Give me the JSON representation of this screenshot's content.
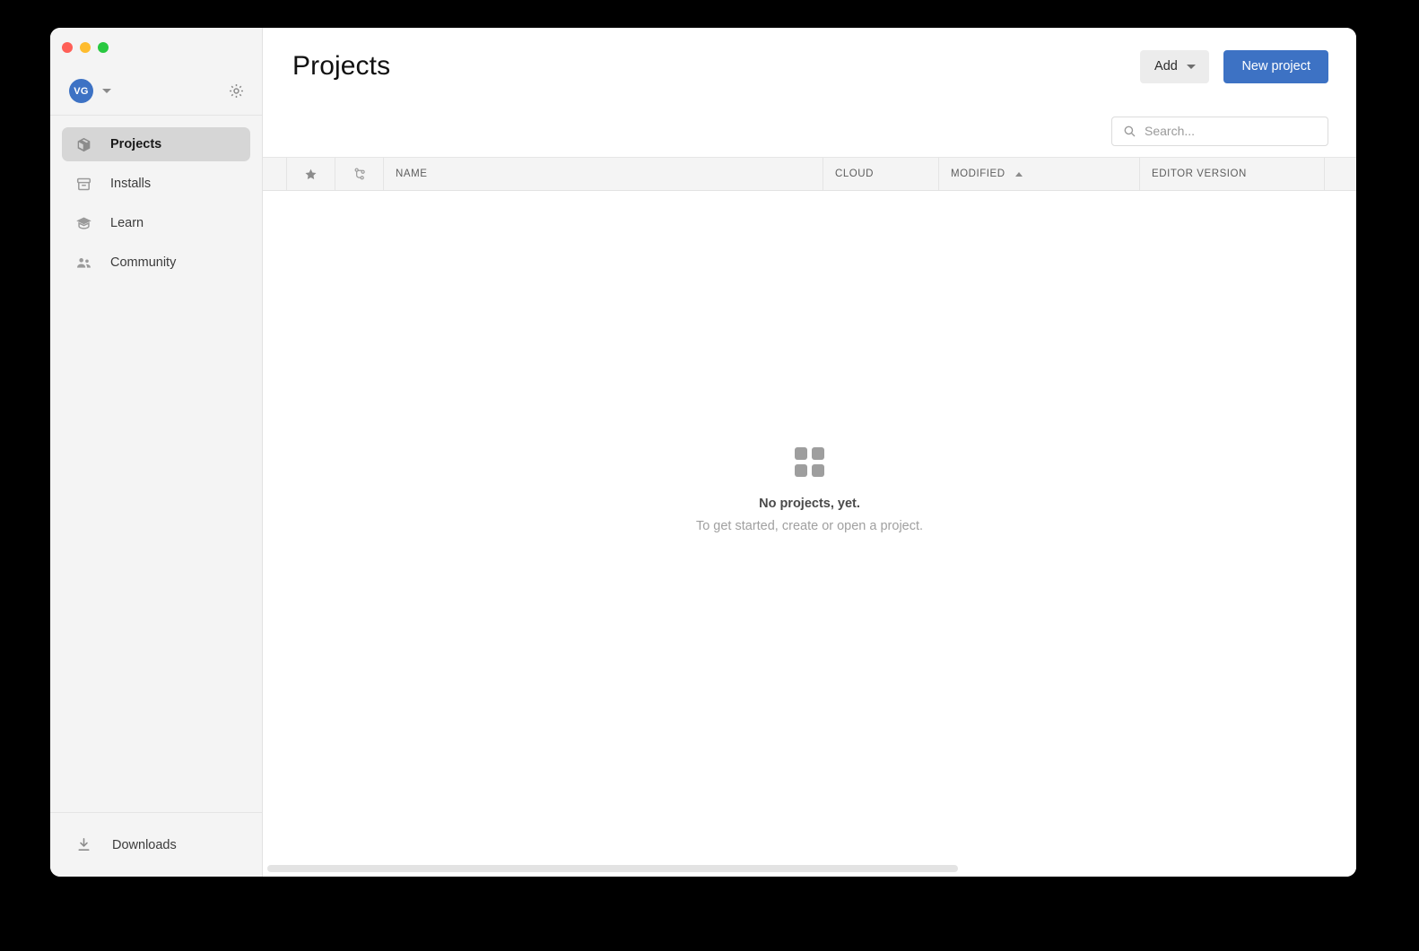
{
  "window": {
    "traffic_lights": [
      {
        "name": "close",
        "color": "#ff5f57"
      },
      {
        "name": "minimize",
        "color": "#febc2e"
      },
      {
        "name": "maximize",
        "color": "#28c840"
      }
    ]
  },
  "sidebar": {
    "account": {
      "avatar_initials": "VG",
      "avatar_color": "#3d72c4",
      "dropdown_icon": "chevron-down-icon",
      "settings_icon": "gear-icon"
    },
    "items": [
      {
        "label": "Projects",
        "icon": "cube-icon",
        "active": true
      },
      {
        "label": "Installs",
        "icon": "archive-icon",
        "active": false
      },
      {
        "label": "Learn",
        "icon": "graduation-cap-icon",
        "active": false
      },
      {
        "label": "Community",
        "icon": "people-icon",
        "active": false
      }
    ],
    "footer": {
      "label": "Downloads",
      "icon": "download-icon"
    }
  },
  "main": {
    "title": "Projects",
    "toolbar": {
      "add_label": "Add",
      "add_caret_icon": "chevron-down-icon",
      "new_project_label": "New project",
      "new_project_color": "#3d72c4"
    },
    "search": {
      "value": "",
      "placeholder": "Search...",
      "icon": "search-icon"
    },
    "table": {
      "columns": [
        {
          "label": "",
          "name": "spacer",
          "icon": ""
        },
        {
          "label": "",
          "name": "favorite",
          "icon": "star-icon"
        },
        {
          "label": "",
          "name": "version-control",
          "icon": "git-branch-icon"
        },
        {
          "label": "NAME",
          "name": "name",
          "icon": ""
        },
        {
          "label": "CLOUD",
          "name": "cloud",
          "icon": ""
        },
        {
          "label": "MODIFIED",
          "name": "modified",
          "icon": "sort-ascending-icon"
        },
        {
          "label": "EDITOR VERSION",
          "name": "editor-version",
          "icon": ""
        },
        {
          "label": "",
          "name": "actions",
          "icon": ""
        }
      ],
      "sort": {
        "column": "MODIFIED",
        "direction": "ascending"
      },
      "rows": []
    },
    "empty_state": {
      "icon": "grid-2x2-icon",
      "title": "No projects, yet.",
      "subtitle": "To get started, create or open a project."
    },
    "horizontal_scrollbar": {
      "name": "horizontal-scrollbar"
    }
  }
}
